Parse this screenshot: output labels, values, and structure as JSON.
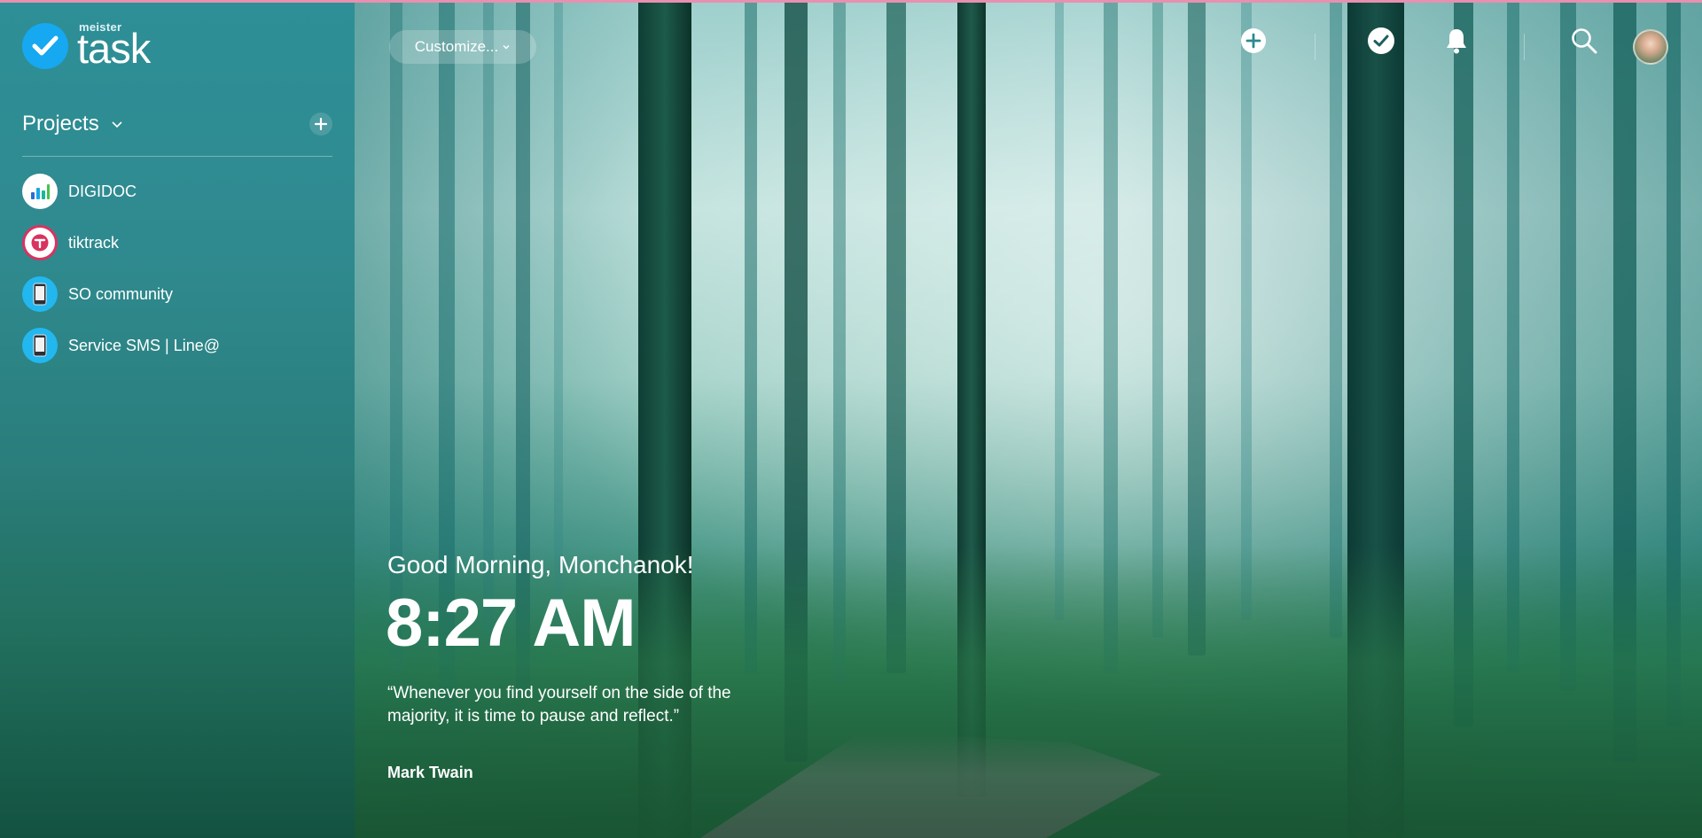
{
  "app": {
    "logo_small": "meister",
    "logo_big": "task"
  },
  "sidebar": {
    "projects_title": "Projects",
    "projects": [
      {
        "label": "DIGIDOC",
        "icon": "bar-chart-icon"
      },
      {
        "label": "tiktrack",
        "icon": "tiktrack-icon"
      },
      {
        "label": "SO community",
        "icon": "phone-icon"
      },
      {
        "label": "Service SMS | Line@",
        "icon": "phone-icon"
      }
    ]
  },
  "topbar": {
    "customize_label": "Customize...",
    "icons": [
      "add-icon",
      "check-icon",
      "bell-icon",
      "search-icon",
      "avatar"
    ]
  },
  "dashboard": {
    "greeting": "Good Morning, Monchanok!",
    "time": "8:27 AM",
    "quote": "“Whenever you find yourself on the side of the majority, it is time to pause and reflect.”",
    "author": "Mark Twain"
  },
  "colors": {
    "brand_blue": "#16a8f0",
    "sidebar_top": "#2e8f97",
    "sidebar_bottom": "#135240",
    "accent_pink": "#e98fb0"
  }
}
